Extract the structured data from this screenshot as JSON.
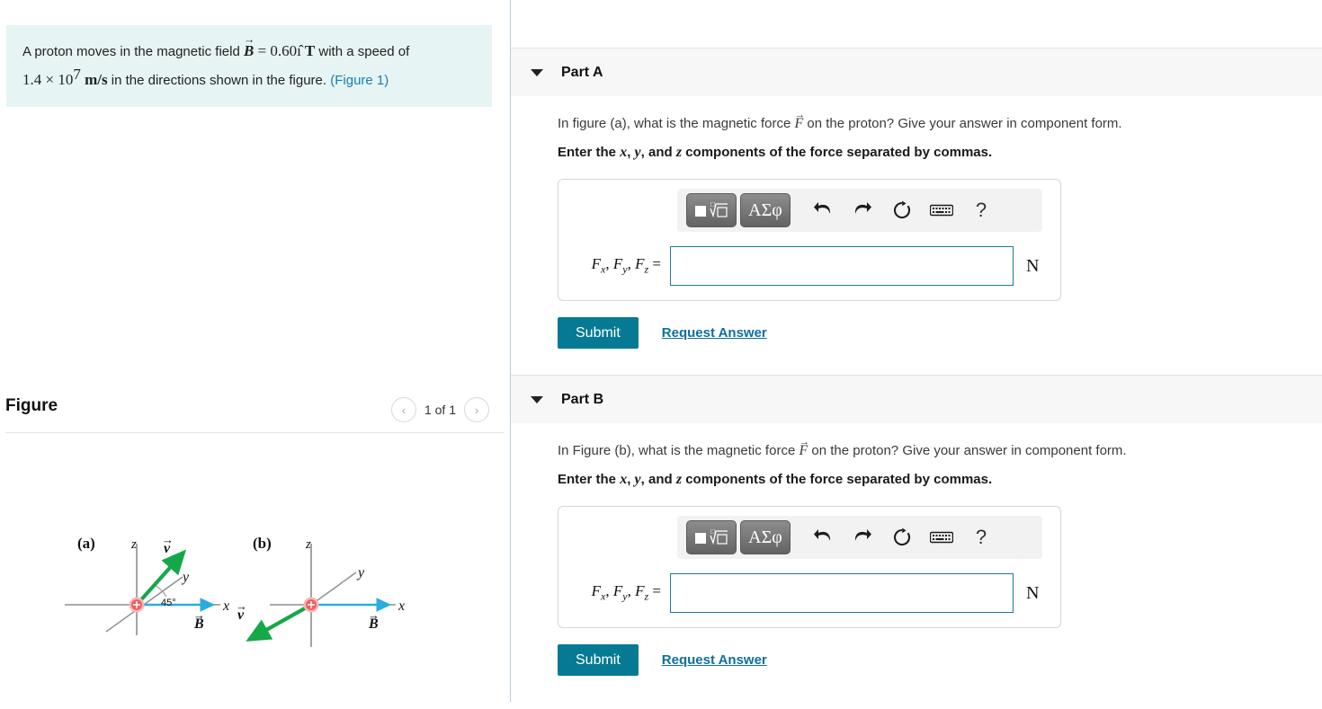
{
  "problem": {
    "text_before_B": "A proton moves in the magnetic field ",
    "B_symbol": "B",
    "B_value": " = 0.60",
    "i_hat": "ı̂",
    "B_unit": " T",
    "text_mid": " with a speed of ",
    "speed": "1.4 × 10",
    "speed_exp": "7",
    "speed_unit": " m/s",
    "text_after": " in the directions shown in the figure. ",
    "figure_link": "(Figure 1)"
  },
  "figure_panel": {
    "title": "Figure",
    "prev_label": "‹",
    "next_label": "›",
    "counter": "1 of 1"
  },
  "diagram": {
    "label_a": "(a)",
    "label_b": "(b)",
    "axis_z": "z",
    "axis_y": "y",
    "axis_x": "x",
    "v_label": "v",
    "B_label": "B",
    "angle_label": "45°",
    "charge_sign": "+",
    "colors": {
      "velocity": "#15a84a",
      "field": "#2aace2",
      "axis": "#8d8d8d",
      "charge_fill": "#f06a6a",
      "charge_ring": "#f7b8b8"
    }
  },
  "toolbar": {
    "template_button": "template-math",
    "greek_button": "ΑΣφ",
    "undo": "undo",
    "redo": "redo",
    "reset": "reset",
    "keyboard": "keyboard",
    "help": "?"
  },
  "parts": [
    {
      "id": "part-a",
      "title": "Part A",
      "caret": "▼",
      "question": "In figure (a), what is the magnetic force ",
      "force_symbol": "F",
      "question_tail": " on the proton? Give your answer in component form.",
      "instruction_pre": "Enter the ",
      "instr_x": "x",
      "instr_c1": ", ",
      "instr_y": "y",
      "instr_c2": ", and ",
      "instr_z": "z",
      "instruction_post": " components of the force separated by commas.",
      "answer_label_F": "F",
      "answer_sub_x": "x",
      "answer_sub_y": "y",
      "answer_sub_z": "z",
      "answer_eq": " = ",
      "answer_value": "",
      "answer_placeholder": "",
      "unit": "N",
      "submit_label": "Submit",
      "request_label": "Request Answer"
    },
    {
      "id": "part-b",
      "title": "Part B",
      "caret": "▼",
      "question": "In Figure (b), what is the magnetic force ",
      "force_symbol": "F",
      "question_tail": " on the proton? Give your answer in component form.",
      "instruction_pre": "Enter the ",
      "instr_x": "x",
      "instr_c1": ", ",
      "instr_y": "y",
      "instr_c2": ", and ",
      "instr_z": "z",
      "instruction_post": " components of the force separated by commas.",
      "answer_label_F": "F",
      "answer_sub_x": "x",
      "answer_sub_y": "y",
      "answer_sub_z": "z",
      "answer_eq": " = ",
      "answer_value": "",
      "answer_placeholder": "",
      "unit": "N",
      "submit_label": "Submit",
      "request_label": "Request Answer"
    }
  ],
  "colors": {
    "accent": "#067a94",
    "link": "#0f6f9e",
    "statement_bg": "#e6f4f3",
    "panel_bg": "#f7f7f7",
    "input_border": "#1c7b92"
  }
}
